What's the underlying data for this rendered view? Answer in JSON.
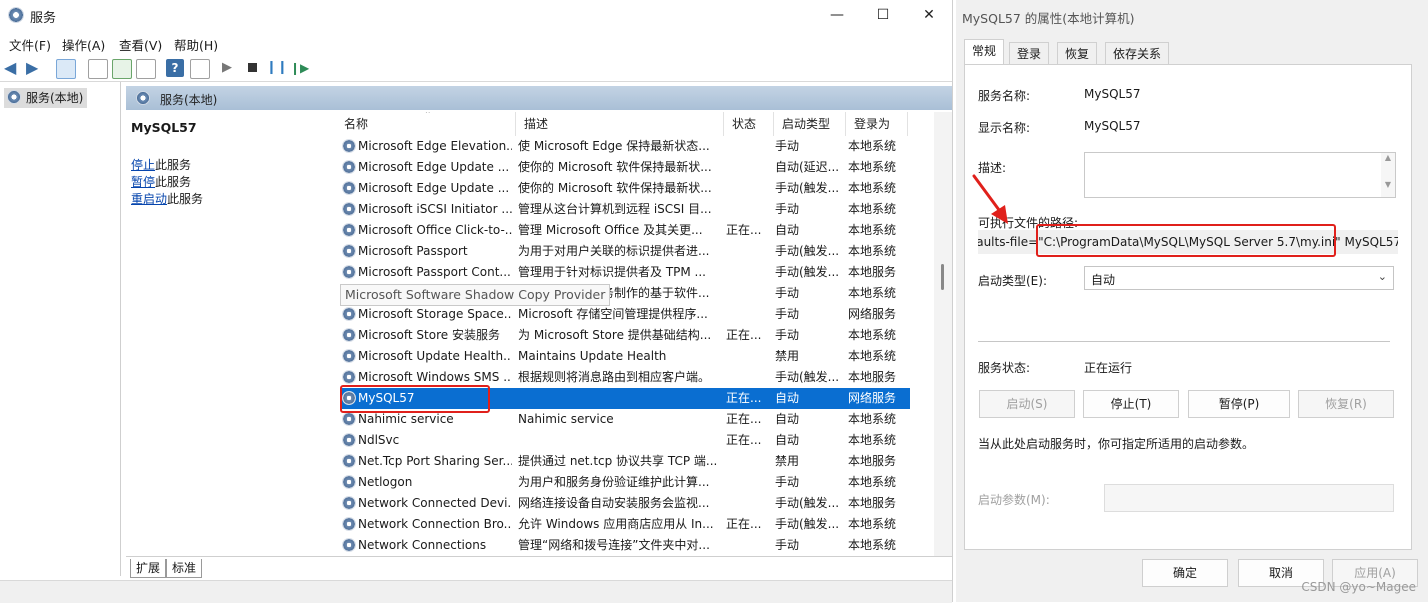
{
  "services_window": {
    "title": "服务",
    "menu": [
      "文件(F)",
      "操作(A)",
      "查看(V)",
      "帮助(H)"
    ],
    "tree_item": "服务(本地)",
    "pane_header": "服务(本地)",
    "selected_name": "MySQL57",
    "actions": [
      {
        "link": "停止",
        "rest": "此服务"
      },
      {
        "link": "暂停",
        "rest": "此服务"
      },
      {
        "link": "重启动",
        "rest": "此服务"
      }
    ],
    "columns": [
      "名称",
      "描述",
      "状态",
      "启动类型",
      "登录为"
    ],
    "rows": [
      {
        "name": "Microsoft Edge Elevation...",
        "desc": "使 Microsoft Edge 保持最新状态...",
        "status": "",
        "startup": "手动",
        "logon": "本地系统"
      },
      {
        "name": "Microsoft Edge Update ...",
        "desc": "使你的 Microsoft 软件保持最新状...",
        "status": "",
        "startup": "自动(延迟...",
        "logon": "本地系统"
      },
      {
        "name": "Microsoft Edge Update ...",
        "desc": "使你的 Microsoft 软件保持最新状...",
        "status": "",
        "startup": "手动(触发...",
        "logon": "本地系统"
      },
      {
        "name": "Microsoft iSCSI Initiator ...",
        "desc": "管理从这台计算机到远程 iSCSI 目...",
        "status": "",
        "startup": "手动",
        "logon": "本地系统"
      },
      {
        "name": "Microsoft Office Click-to-...",
        "desc": "管理 Microsoft Office 及其关更...",
        "status": "正在...",
        "startup": "自动",
        "logon": "本地系统"
      },
      {
        "name": "Microsoft Passport",
        "desc": "为用于对用户关联的标识提供者进...",
        "status": "",
        "startup": "手动(触发...",
        "logon": "本地系统"
      },
      {
        "name": "Microsoft Passport Cont...",
        "desc": "管理用于针对标识提供者及 TPM ...",
        "status": "",
        "startup": "手动(触发...",
        "logon": "本地服务"
      },
      {
        "name": "Microsoft Software Shadow Copy Provider",
        "desc": "管理卷影复制服务制作的基于软件...",
        "status": "",
        "startup": "手动",
        "logon": "本地系统"
      },
      {
        "name": "Microsoft Storage Space...",
        "desc": "Microsoft 存储空间管理提供程序...",
        "status": "",
        "startup": "手动",
        "logon": "网络服务"
      },
      {
        "name": "Microsoft Store 安装服务",
        "desc": "为 Microsoft Store 提供基础结构...",
        "status": "正在...",
        "startup": "手动",
        "logon": "本地系统"
      },
      {
        "name": "Microsoft Update Health...",
        "desc": "Maintains Update Health",
        "status": "",
        "startup": "禁用",
        "logon": "本地系统"
      },
      {
        "name": "Microsoft Windows SMS ...",
        "desc": "根据规则将消息路由到相应客户端。",
        "status": "",
        "startup": "手动(触发...",
        "logon": "本地服务"
      },
      {
        "name": "MySQL57",
        "desc": "",
        "status": "正在...",
        "startup": "自动",
        "logon": "网络服务"
      },
      {
        "name": "Nahimic service",
        "desc": "Nahimic service",
        "status": "正在...",
        "startup": "自动",
        "logon": "本地系统"
      },
      {
        "name": "NdlSvc",
        "desc": "",
        "status": "正在...",
        "startup": "自动",
        "logon": "本地系统"
      },
      {
        "name": "Net.Tcp Port Sharing Ser...",
        "desc": "提供通过 net.tcp 协议共享 TCP 端...",
        "status": "",
        "startup": "禁用",
        "logon": "本地服务"
      },
      {
        "name": "Netlogon",
        "desc": "为用户和服务身份验证维护此计算...",
        "status": "",
        "startup": "手动",
        "logon": "本地系统"
      },
      {
        "name": "Network Connected Devi...",
        "desc": "网络连接设备自动安装服务会监视...",
        "status": "",
        "startup": "手动(触发...",
        "logon": "本地服务"
      },
      {
        "name": "Network Connection Bro...",
        "desc": "允许 Windows 应用商店应用从 In...",
        "status": "正在...",
        "startup": "手动(触发...",
        "logon": "本地系统"
      },
      {
        "name": "Network Connections",
        "desc": "管理“网络和拨号连接”文件夹中对...",
        "status": "",
        "startup": "手动",
        "logon": "本地系统"
      }
    ],
    "bottom_tabs": [
      "扩展",
      "标准"
    ]
  },
  "properties_dialog": {
    "title": "MySQL57 的属性(本地计算机)",
    "tabs": [
      "常规",
      "登录",
      "恢复",
      "依存关系"
    ],
    "service_name_label": "服务名称:",
    "service_name": "MySQL57",
    "display_name_label": "显示名称:",
    "display_name": "MySQL57",
    "description_label": "描述:",
    "exe_path_label": "可执行文件的路径:",
    "exe_path_prefix": "faults-file=",
    "exe_path_highlight": "\"C:\\ProgramData\\MySQL\\MySQL Server 5.7\\my.ini\"",
    "exe_path_suffix": " MySQL57",
    "startup_type_label": "启动类型(E):",
    "startup_type": "自动",
    "status_label": "服务状态:",
    "status_value": "正在运行",
    "btn_start": "启动(S)",
    "btn_stop": "停止(T)",
    "btn_pause": "暂停(P)",
    "btn_resume": "恢复(R)",
    "hint": "当从此处启动服务时，你可指定所适用的启动参数。",
    "params_label": "启动参数(M):",
    "btn_ok": "确定",
    "btn_cancel": "取消",
    "btn_apply": "应用(A)"
  },
  "watermark": "CSDN @yo~Magee",
  "colors": {
    "selection": "#0a6ed1",
    "annotation": "#e0201b",
    "pane_header": "#b8cadd"
  }
}
